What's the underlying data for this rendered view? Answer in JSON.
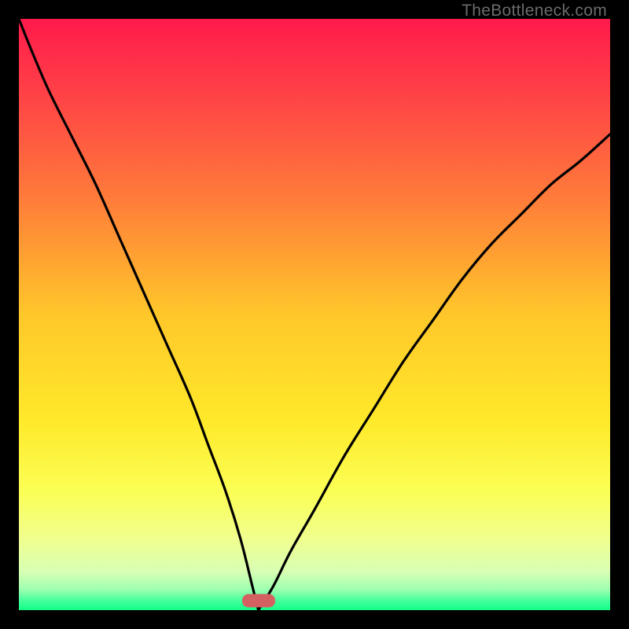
{
  "watermark": "TheBottleneck.com",
  "chart_data": {
    "type": "line",
    "title": "",
    "xlabel": "",
    "ylabel": "",
    "xlim": [
      0,
      1
    ],
    "ylim": [
      0,
      1
    ],
    "gradient_stops": [
      {
        "offset": 0.0,
        "color": "#ff1a4b"
      },
      {
        "offset": 0.12,
        "color": "#ff3f47"
      },
      {
        "offset": 0.3,
        "color": "#ff7a3a"
      },
      {
        "offset": 0.5,
        "color": "#ffc72a"
      },
      {
        "offset": 0.68,
        "color": "#ffe92a"
      },
      {
        "offset": 0.8,
        "color": "#fbff55"
      },
      {
        "offset": 0.88,
        "color": "#f0ff8f"
      },
      {
        "offset": 0.935,
        "color": "#d8ffb4"
      },
      {
        "offset": 0.965,
        "color": "#9dffb0"
      },
      {
        "offset": 0.985,
        "color": "#40ff9c"
      },
      {
        "offset": 1.0,
        "color": "#13ff86"
      }
    ],
    "curve": {
      "minimum_x": 0.405,
      "left": [
        {
          "x": 0.0,
          "y": 1.0
        },
        {
          "x": 0.02,
          "y": 0.95
        },
        {
          "x": 0.05,
          "y": 0.88
        },
        {
          "x": 0.09,
          "y": 0.8
        },
        {
          "x": 0.13,
          "y": 0.72
        },
        {
          "x": 0.17,
          "y": 0.63
        },
        {
          "x": 0.21,
          "y": 0.54
        },
        {
          "x": 0.25,
          "y": 0.45
        },
        {
          "x": 0.29,
          "y": 0.36
        },
        {
          "x": 0.32,
          "y": 0.28
        },
        {
          "x": 0.35,
          "y": 0.2
        },
        {
          "x": 0.375,
          "y": 0.12
        },
        {
          "x": 0.395,
          "y": 0.04
        },
        {
          "x": 0.405,
          "y": 0.0
        }
      ],
      "right": [
        {
          "x": 0.405,
          "y": 0.0
        },
        {
          "x": 0.43,
          "y": 0.04
        },
        {
          "x": 0.46,
          "y": 0.1
        },
        {
          "x": 0.5,
          "y": 0.17
        },
        {
          "x": 0.55,
          "y": 0.26
        },
        {
          "x": 0.6,
          "y": 0.34
        },
        {
          "x": 0.65,
          "y": 0.42
        },
        {
          "x": 0.7,
          "y": 0.49
        },
        {
          "x": 0.75,
          "y": 0.56
        },
        {
          "x": 0.8,
          "y": 0.62
        },
        {
          "x": 0.85,
          "y": 0.67
        },
        {
          "x": 0.9,
          "y": 0.72
        },
        {
          "x": 0.95,
          "y": 0.76
        },
        {
          "x": 1.0,
          "y": 0.805
        }
      ]
    },
    "marker": {
      "x": 0.405,
      "y": 0.01
    }
  }
}
